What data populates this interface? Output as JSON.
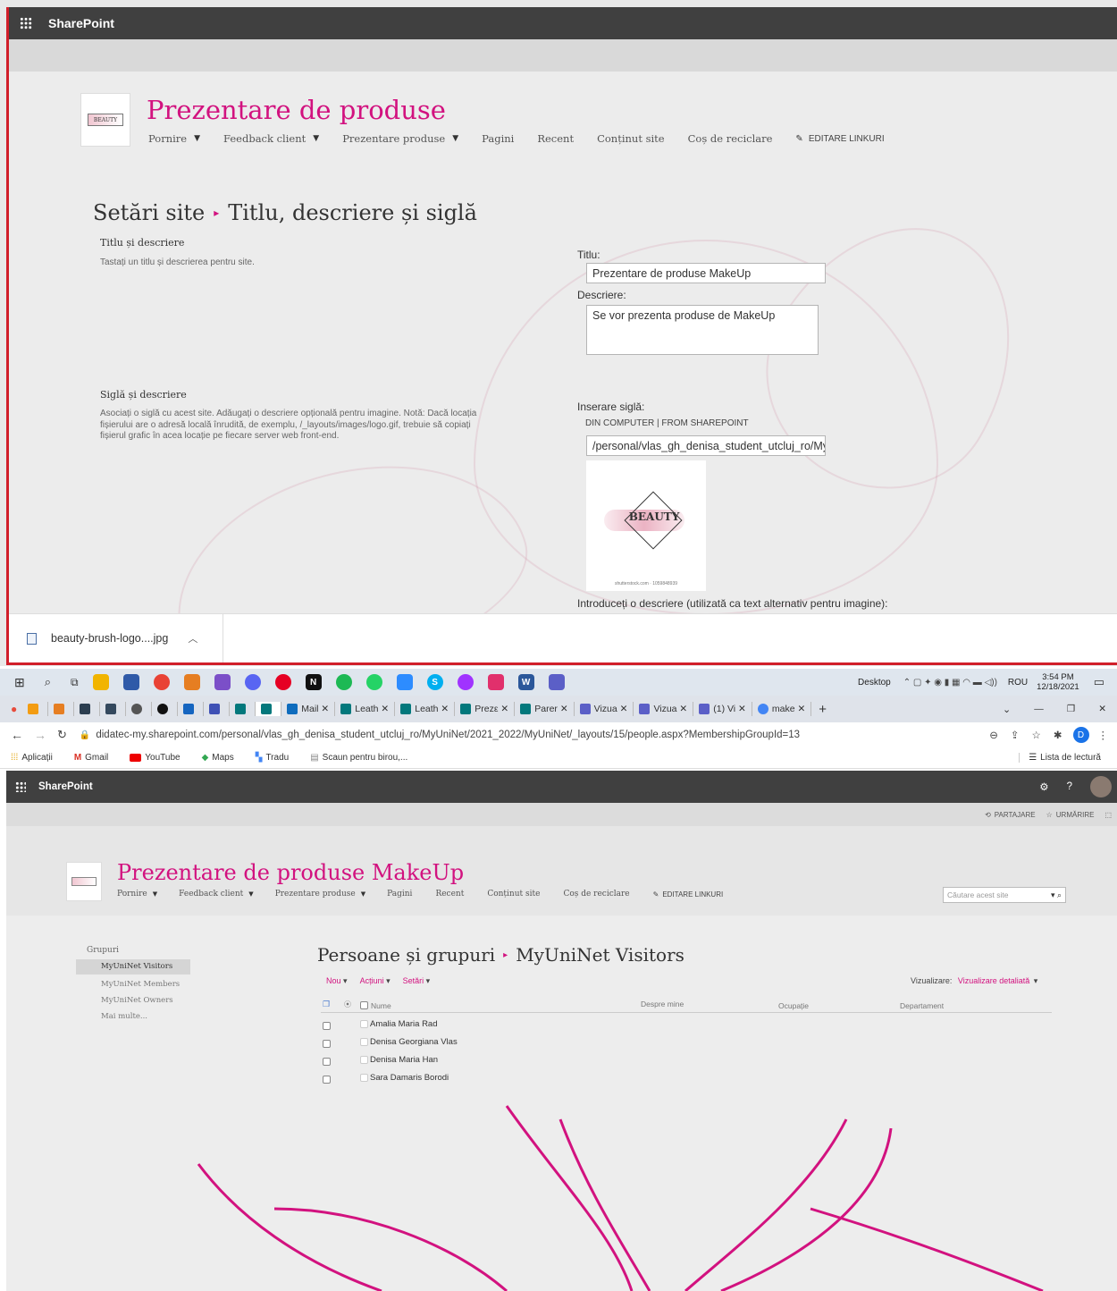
{
  "top": {
    "app_name": "SharePoint",
    "site_title": "Prezentare de produse",
    "nav": [
      "Pornire",
      "Feedback client",
      "Prezentare produse",
      "Pagini",
      "Recent",
      "Conținut site",
      "Coș de reciclare"
    ],
    "edit_links": "EDITARE LINKURI",
    "logo_text": "BEAUTY",
    "breadcrumb_root": "Setări site",
    "breadcrumb_page": "Titlu, descriere și siglă",
    "section1_title": "Titlu și descriere",
    "section1_desc": "Tastați un titlu și descrierea pentru site.",
    "title_label": "Titlu:",
    "title_value": "Prezentare de produse MakeUp",
    "desc_label": "Descriere:",
    "desc_value": "Se vor prezenta produse de MakeUp",
    "section2_title": "Siglă și descriere",
    "section2_desc": "Asociați o siglă cu acest site. Adăugați o descriere opțională pentru imagine. Notă: Dacă locația fișierului are o adresă locală înrudită, de exemplu, /_layouts/images/logo.gif, trebuie să copiați fișierul grafic în acea locație pe fiecare server web front-end.",
    "insert_logo_label": "Inserare siglă:",
    "insert_logo_sources": "DIN COMPUTER | FROM SHAREPOINT",
    "logo_path": "/personal/vlas_gh_denisa_student_utcluj_ro/MyU",
    "logo_preview_text": "BEAUTY",
    "logo_preview_caption": "shutterstock.com · 1059848939",
    "alt_text_label": "Introduceți o descriere (utilizată ca text alternativ pentru imagine):",
    "download_file": "beauty-brush-logo....jpg"
  },
  "taskbar": {
    "desktop_label": "Desktop",
    "lang": "ROU",
    "time": "3:54 PM",
    "date": "12/18/2021"
  },
  "browser": {
    "tabs": [
      "Mail",
      "Leath",
      "Leath",
      "Prezε",
      "Parer",
      "Vizua",
      "Vizua",
      "(1) Vi",
      "make"
    ],
    "url": "didatec-my.sharepoint.com/personal/vlas_gh_denisa_student_utcluj_ro/MyUniNet/2021_2022/MyUniNet/_layouts/15/people.aspx?MembershipGroupId=13",
    "bookmarks": [
      "Aplicații",
      "Gmail",
      "YouTube",
      "Maps",
      "Tradu",
      "Scaun pentru birou,..."
    ],
    "reading_list": "Lista de lectură",
    "profile_initial": "D"
  },
  "bottom": {
    "app_name": "SharePoint",
    "share": "PARTAJARE",
    "follow": "URMĂRIRE",
    "site_title": "Prezentare de produse MakeUp",
    "nav": [
      "Pornire",
      "Feedback client",
      "Prezentare produse",
      "Pagini",
      "Recent",
      "Conținut site",
      "Coș de reciclare"
    ],
    "edit_links": "EDITARE LINKURI",
    "search_placeholder": "Căutare acest site",
    "groups_title": "Grupuri",
    "groups": [
      "MyUniNet Visitors",
      "MyUniNet Members",
      "MyUniNet Owners",
      "Mai multe..."
    ],
    "page_root": "Persoane și grupuri",
    "page_group": "MyUniNet Visitors",
    "toolbar": [
      "Nou",
      "Acțiuni",
      "Setări"
    ],
    "view_label": "Vizualizare:",
    "view_value": "Vizualizare detaliată",
    "columns": [
      "Nume",
      "Despre mine",
      "Ocupație",
      "Departament"
    ],
    "people": [
      "Amalia Maria Rad",
      "Denisa Georgiana Vlas",
      "Denisa Maria Han",
      "Sara Damaris Borodi"
    ]
  },
  "colors": {
    "accent": "#d2127f",
    "suitebar": "#404040",
    "frame": "#d11e2a"
  }
}
